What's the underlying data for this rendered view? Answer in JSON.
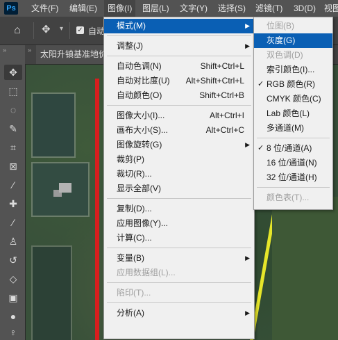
{
  "app": {
    "logo": "Ps"
  },
  "menubar": [
    "文件(F)",
    "编辑(E)",
    "图像(I)",
    "图层(L)",
    "文字(Y)",
    "选择(S)",
    "滤镜(T)",
    "3D(D)",
    "视图"
  ],
  "options": {
    "auto_label": "自动"
  },
  "document": {
    "tab_title": "太阳升镇基准地价"
  },
  "image_menu": [
    {
      "label": "模式(M)",
      "submenu": true,
      "highlight": true
    },
    {
      "sep": true
    },
    {
      "label": "调整(J)",
      "submenu": true
    },
    {
      "sep": true
    },
    {
      "label": "自动色调(N)",
      "shortcut": "Shift+Ctrl+L"
    },
    {
      "label": "自动对比度(U)",
      "shortcut": "Alt+Shift+Ctrl+L"
    },
    {
      "label": "自动颜色(O)",
      "shortcut": "Shift+Ctrl+B"
    },
    {
      "sep": true
    },
    {
      "label": "图像大小(I)...",
      "shortcut": "Alt+Ctrl+I"
    },
    {
      "label": "画布大小(S)...",
      "shortcut": "Alt+Ctrl+C"
    },
    {
      "label": "图像旋转(G)",
      "submenu": true
    },
    {
      "label": "裁剪(P)"
    },
    {
      "label": "裁切(R)..."
    },
    {
      "label": "显示全部(V)"
    },
    {
      "sep": true
    },
    {
      "label": "复制(D)..."
    },
    {
      "label": "应用图像(Y)..."
    },
    {
      "label": "计算(C)..."
    },
    {
      "sep": true
    },
    {
      "label": "变量(B)",
      "submenu": true
    },
    {
      "label": "应用数据组(L)...",
      "disabled": true
    },
    {
      "sep": true
    },
    {
      "label": "陷印(T)...",
      "disabled": true
    },
    {
      "sep": true
    },
    {
      "label": "分析(A)",
      "submenu": true
    }
  ],
  "mode_submenu": [
    {
      "label": "位图(B)",
      "disabled": true
    },
    {
      "label": "灰度(G)",
      "highlight": true
    },
    {
      "label": "双色调(D)",
      "disabled": true
    },
    {
      "label": "索引颜色(I)..."
    },
    {
      "label": "RGB 颜色(R)",
      "checked": true
    },
    {
      "label": "CMYK 颜色(C)"
    },
    {
      "label": "Lab 颜色(L)"
    },
    {
      "label": "多通道(M)"
    },
    {
      "sep": true
    },
    {
      "label": "8 位/通道(A)",
      "checked": true
    },
    {
      "label": "16 位/通道(N)"
    },
    {
      "label": "32 位/通道(H)"
    },
    {
      "sep": true
    },
    {
      "label": "颜色表(T)...",
      "disabled": true
    }
  ],
  "tools": [
    "move-tool-icon",
    "marquee-icon",
    "lasso-icon",
    "quick-select-icon",
    "crop-icon",
    "frame-icon",
    "eyedropper-icon",
    "healing-brush-icon",
    "brush-icon",
    "clone-stamp-icon",
    "history-brush-icon",
    "eraser-icon",
    "gradient-icon",
    "blur-icon",
    "dodge-icon"
  ],
  "colors": {
    "menu_highlight": "#0a5fb4",
    "menubar_bg": "#535353",
    "menu_bg": "#f0f0f0"
  }
}
